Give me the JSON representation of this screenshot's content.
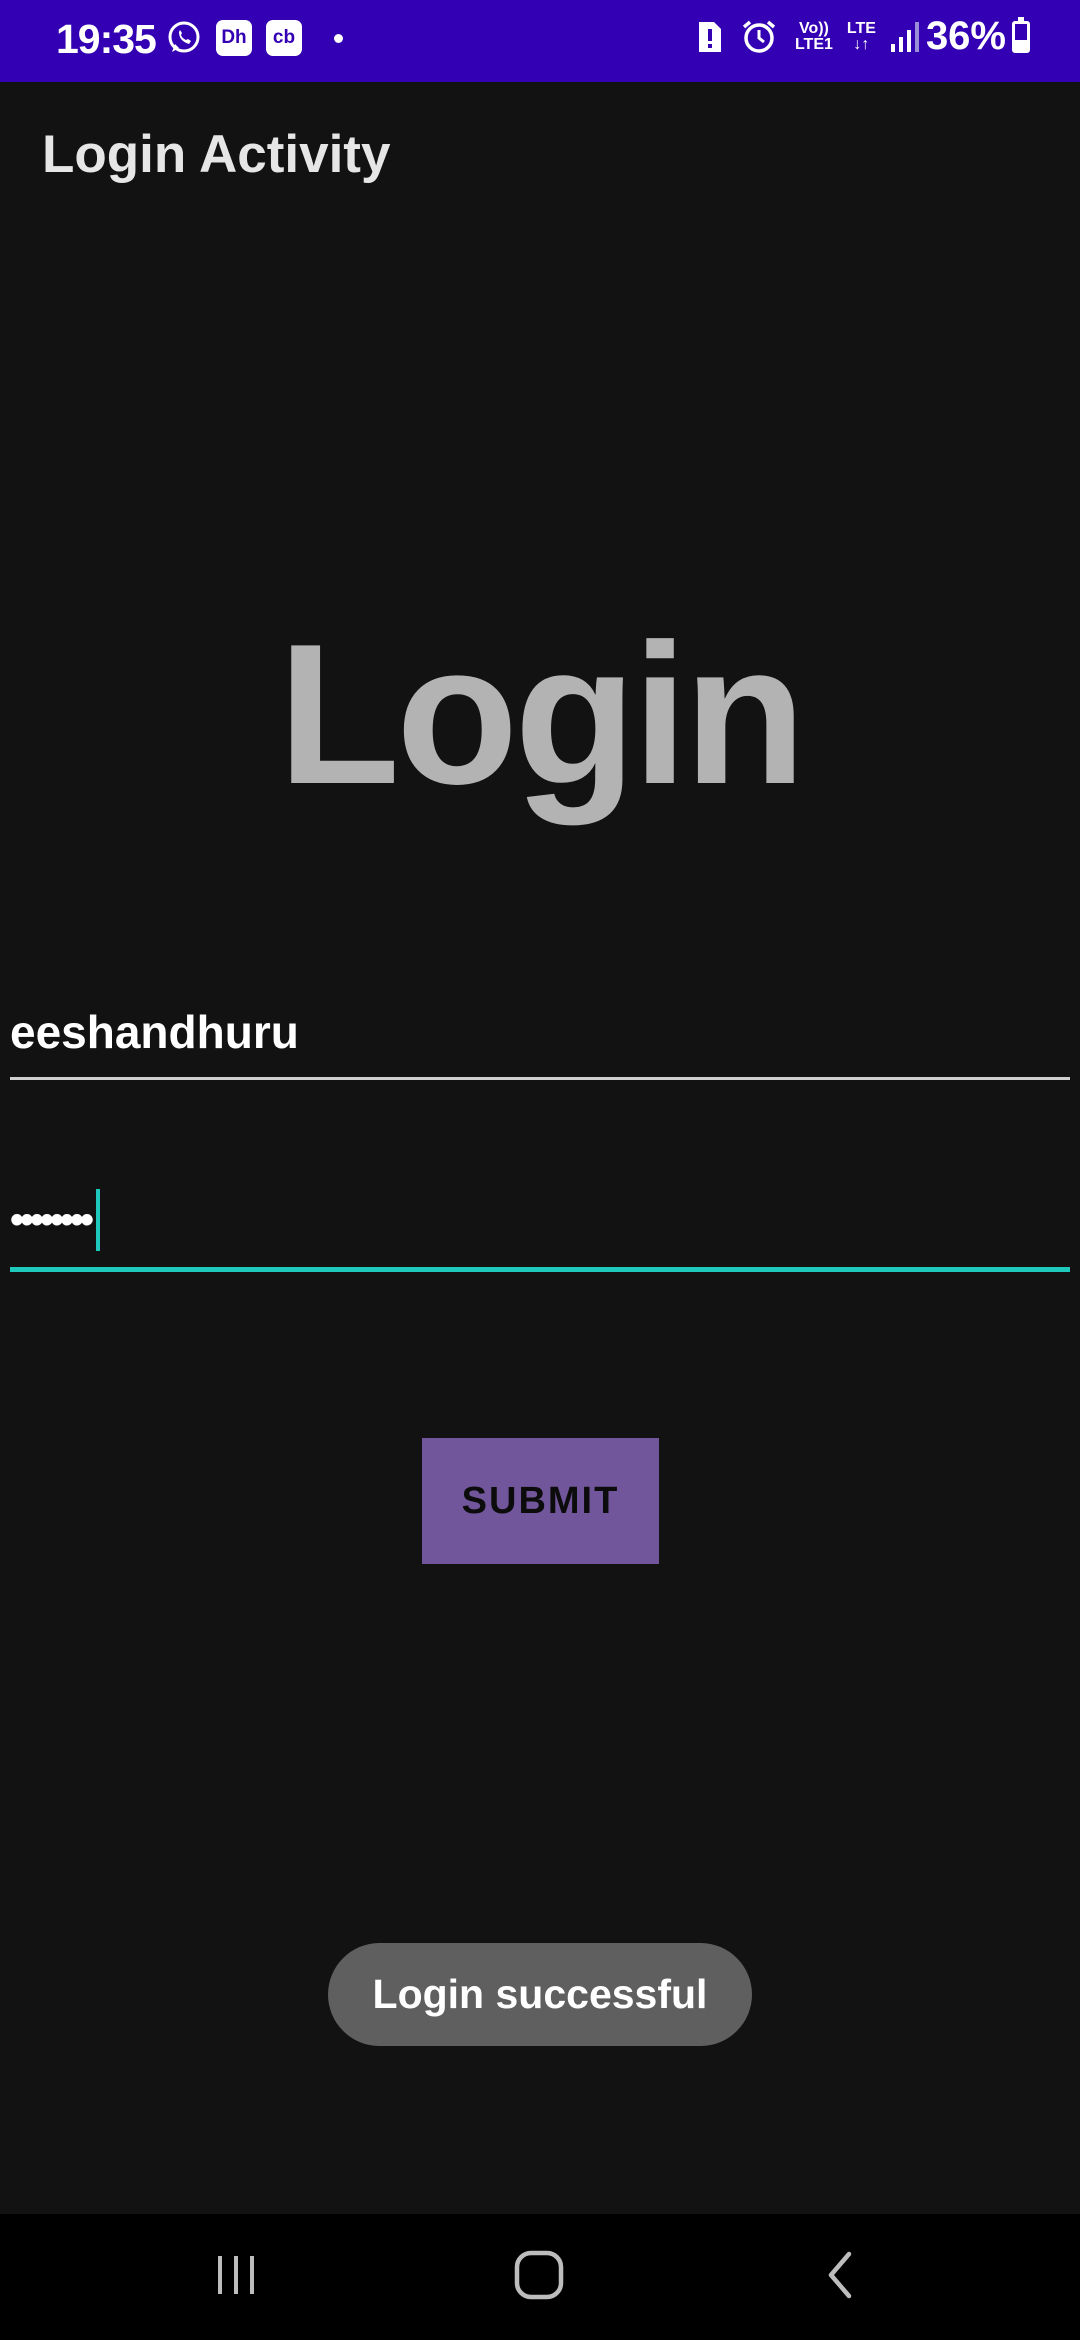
{
  "status_bar": {
    "time": "19:35",
    "left_icons": [
      "whatsapp-icon",
      "dh-icon",
      "cb-icon",
      "notification-dot"
    ],
    "dh_label": "Dh",
    "cb_label": "cb",
    "volte_top": "Vo))",
    "volte_bottom": "LTE1",
    "lte_label": "LTE",
    "battery_percent": "36%",
    "battery_level": 0.36,
    "background_color": "#3300b3"
  },
  "toolbar": {
    "title": "Login Activity"
  },
  "main": {
    "heading": "Login",
    "username_value": "eeshandhuru",
    "password_mask": "••••••••",
    "submit_label": "SUBMIT",
    "accent_color": "#1ec8bd",
    "button_color": "#72569b"
  },
  "toast": {
    "message": "Login successful"
  },
  "nav_bar": {
    "buttons": [
      "recents-icon",
      "home-icon",
      "back-icon"
    ]
  }
}
